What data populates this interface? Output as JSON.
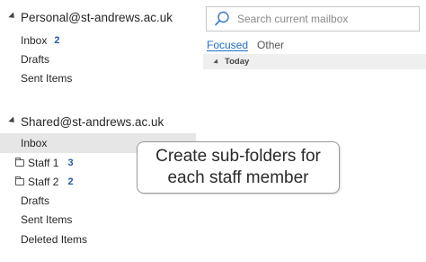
{
  "accounts": [
    {
      "name": "Personal@st-andrews.ac.uk",
      "folders": [
        {
          "label": "Inbox",
          "count": "2"
        },
        {
          "label": "Drafts",
          "count": ""
        },
        {
          "label": "Sent Items",
          "count": ""
        }
      ]
    },
    {
      "name": "Shared@st-andrews.ac.uk",
      "folders": [
        {
          "label": "Inbox",
          "count": "",
          "selected": true
        },
        {
          "label": "Staff 1",
          "count": "3",
          "icon": "folder-icon"
        },
        {
          "label": "Staff 2",
          "count": "2",
          "icon": "folder-icon"
        },
        {
          "label": "Drafts",
          "count": ""
        },
        {
          "label": "Sent Items",
          "count": ""
        },
        {
          "label": "Deleted Items",
          "count": ""
        }
      ]
    }
  ],
  "search": {
    "placeholder": "Search current mailbox",
    "icon": "search-icon"
  },
  "tabs": [
    {
      "label": "Focused",
      "active": true
    },
    {
      "label": "Other",
      "active": false
    }
  ],
  "group_header": "Today",
  "callout": "Create sub-folders for\neach staff member",
  "colors": {
    "accent": "#1e6fc4",
    "count": "#1e5aa8",
    "selected_bg": "#e6e6e6"
  }
}
